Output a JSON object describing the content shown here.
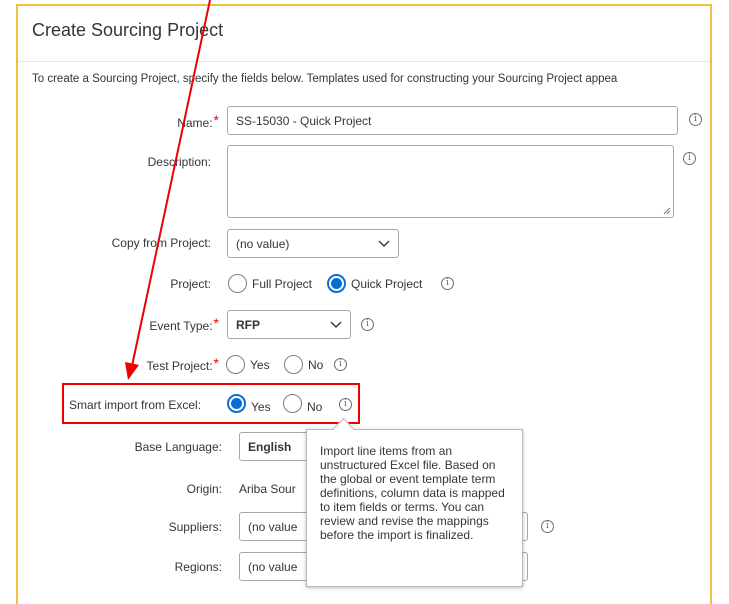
{
  "page": {
    "title": "Create Sourcing Project",
    "intro": "To create a Sourcing Project, specify the fields below. Templates used for constructing your Sourcing Project appea"
  },
  "form": {
    "name": {
      "label": "Name:",
      "value": "SS-15030 - Quick Project"
    },
    "description": {
      "label": "Description:",
      "value": ""
    },
    "copy_from_project": {
      "label": "Copy from Project:",
      "value": "(no value)"
    },
    "project": {
      "label": "Project:",
      "options": [
        "Full Project",
        "Quick Project"
      ],
      "selected": "Quick Project"
    },
    "event_type": {
      "label": "Event Type:",
      "value": "RFP"
    },
    "test_project": {
      "label": "Test Project:",
      "options": [
        "Yes",
        "No"
      ],
      "selected": ""
    },
    "smart_import": {
      "label": "Smart import from Excel:",
      "options": [
        "Yes",
        "No"
      ],
      "selected": "Yes"
    },
    "base_language": {
      "label": "Base Language:",
      "value": "English"
    },
    "origin": {
      "label": "Origin:",
      "value": "Ariba Sour"
    },
    "suppliers": {
      "label": "Suppliers:",
      "value": "(no value"
    },
    "regions": {
      "label": "Regions:",
      "value": "(no value"
    },
    "required_marker": "*"
  },
  "tooltip": {
    "text": "Import line items from an unstructured Excel file. Based on the global or event template term definitions, column data is mapped to item fields or terms. You can review and revise the mappings before the import is finalized."
  },
  "icons": {
    "info": "info-icon",
    "chevron": "chevron-down-icon",
    "resize": "resize-grip-icon"
  },
  "colors": {
    "accent": "#0a6ed1",
    "highlight": "#e00000",
    "panel_border": "#f0c040",
    "required": "#e00000"
  }
}
